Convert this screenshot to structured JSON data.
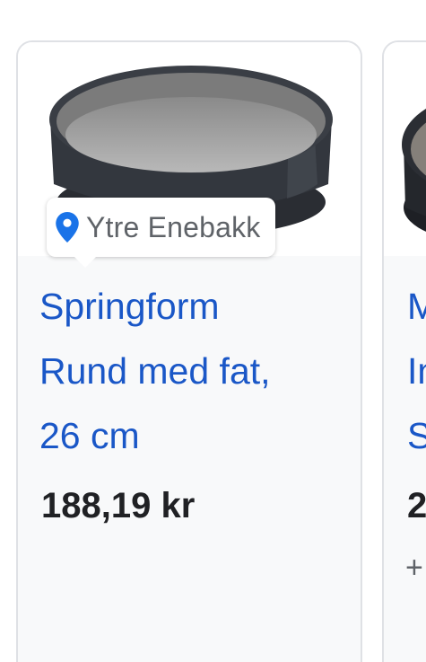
{
  "colors": {
    "title_link": "#1a57c7",
    "pin": "#1a73e8",
    "card_background": "#f8f9fa",
    "card_border": "#dfe1e5"
  },
  "cards": [
    {
      "location_icon": "location-pin-icon",
      "location": "Ytre Enebakk",
      "title_lines": [
        "Springform",
        "Rund med fat,",
        "26 cm"
      ],
      "price": "188,19 kr"
    },
    {
      "title_lines": [
        "M",
        "In",
        "S"
      ],
      "price": "2",
      "extra": "+"
    }
  ]
}
